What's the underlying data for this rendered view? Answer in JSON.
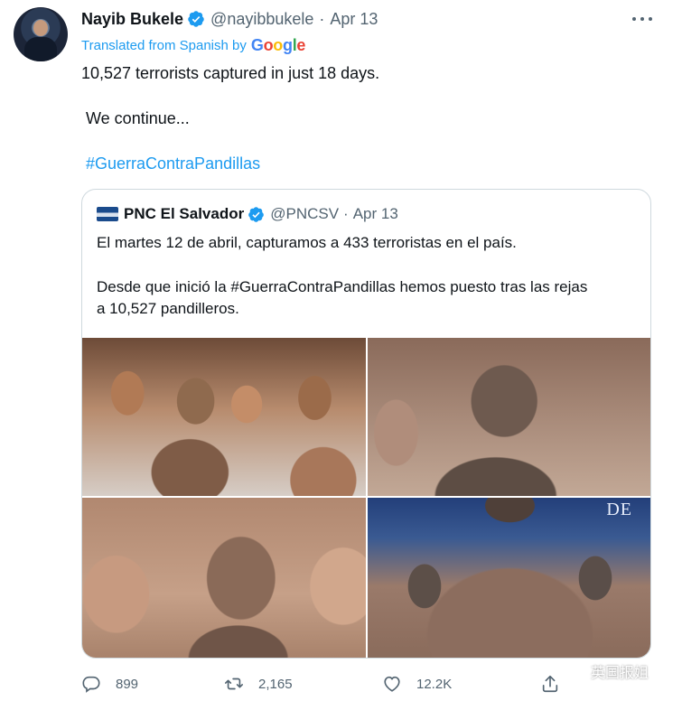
{
  "tweet": {
    "author_name": "Nayib Bukele",
    "handle": "@nayibbukele",
    "separator": "·",
    "date": "Apr 13",
    "translated_label": "Translated from Spanish by",
    "translator": "Google",
    "line1": "10,527 terrorists captured in just 18 days.",
    "line2": " We continue...",
    "hashtag": " #GuerraContraPandillas"
  },
  "quoted": {
    "author_name": "PNC El Salvador",
    "handle": "@PNCSV",
    "separator": "·",
    "date": "Apr 13",
    "para1": "El martes 12 de abril, capturamos a 433 terroristas en el país.",
    "para2_line1": "Desde que inició la #GuerraContraPandillas hemos puesto tras las rejas",
    "para2_line2": "a 10,527 pandilleros.",
    "photo4_sign": "DE"
  },
  "actions": {
    "replies": "899",
    "retweets": "2,165",
    "likes": "12.2K"
  },
  "watermark": {
    "text": "英国报姐"
  },
  "colors": {
    "accent": "#1d9bf0",
    "secondary_text": "#536471",
    "border": "#cfd9de"
  },
  "icons": [
    "verified-badge-icon",
    "more-options-icon",
    "reply-icon",
    "retweet-icon",
    "like-icon",
    "share-icon",
    "wechat-icon"
  ]
}
